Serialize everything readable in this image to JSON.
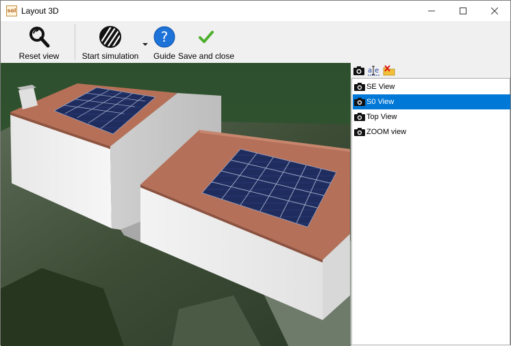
{
  "window": {
    "title": "Layout 3D",
    "app_icon_text": "sol"
  },
  "toolbar": {
    "reset_label": "Reset view",
    "simulation_label": "Start simulation",
    "guide_label": "Guide",
    "save_label": "Save and close"
  },
  "views_panel": {
    "selected_index": 1,
    "items": [
      {
        "label": "SE View"
      },
      {
        "label": "S0 View"
      },
      {
        "label": "Top View"
      },
      {
        "label": "ZOOM view"
      }
    ]
  },
  "icons": {
    "reset": "magnifier-icon",
    "simulation": "sun-shade-icon",
    "guide": "help-icon",
    "save": "checkmark-icon",
    "camera": "camera-icon",
    "rename": "rename-icon",
    "delete": "delete-folder-icon"
  },
  "colors": {
    "accent": "#0078d7",
    "guide_blue": "#1e73d8",
    "save_green": "#4caf2a",
    "roof": "#b5705a",
    "panel": "#1d2a5a"
  }
}
